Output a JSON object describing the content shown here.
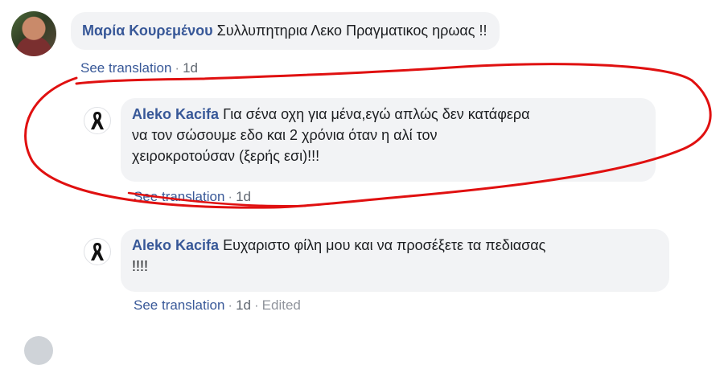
{
  "comments": [
    {
      "author": "Μαρία Κουρεμένου",
      "text": "Συλλυπητηρια Λεκο Πραγματικος ηρωας !!",
      "see_translation": "See translation",
      "time": "1d"
    },
    {
      "author": "Aleko Kacifa",
      "text_lines": [
        "Για σένα οχη για μένα,εγώ απλώς δεν κατάφερα",
        "να τον σώσουμε εδο και 2 χρόνια όταν η αλί τον",
        "χειροκροτούσαν (ξερής εσι)!!!"
      ],
      "see_translation": "See translation",
      "time": "1d"
    },
    {
      "author": "Aleko Kacifa",
      "text_lines": [
        "Ευχαριστο φίλη μου και να προσέξετε τα πεδιασας",
        "!!!!"
      ],
      "see_translation": "See translation",
      "time": "1d",
      "edited": "Edited"
    }
  ],
  "colors": {
    "annotation": "#e01010",
    "link": "#385898",
    "bubble": "#f2f3f5"
  },
  "icons": {
    "reply_avatar": "black-ribbon-icon"
  }
}
